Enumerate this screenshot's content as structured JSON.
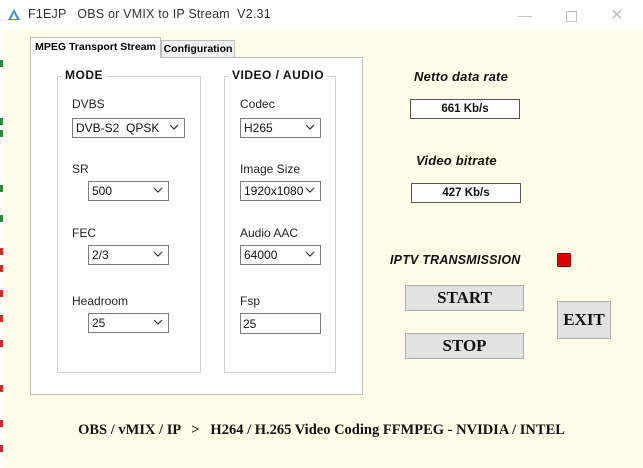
{
  "window": {
    "title": "F1EJP   OBS or VMIX to IP Stream  V2.31"
  },
  "tabs": [
    {
      "label": "MPEG Transport Stream",
      "active": true
    },
    {
      "label": "Configuration",
      "active": false
    }
  ],
  "mode": {
    "title": "MODE",
    "dvbs": {
      "label": "DVBS",
      "value": "DVB-S2  QPSK"
    },
    "sr": {
      "label": "SR",
      "value": "500"
    },
    "fec": {
      "label": "FEC",
      "value": "2/3"
    },
    "headroom": {
      "label": "Headroom",
      "value": "25"
    }
  },
  "video_audio": {
    "title": "VIDEO / AUDIO",
    "codec": {
      "label": "Codec",
      "value": "H265"
    },
    "image_size": {
      "label": "Image Size",
      "value": "1920x1080"
    },
    "audio_aac": {
      "label": "Audio AAC",
      "value": "64000"
    },
    "fsp": {
      "label": "Fsp",
      "value": "25"
    }
  },
  "stats": {
    "netto_label": "Netto data rate",
    "netto_value": "661 Kb/s",
    "video_label": "Video bitrate",
    "video_value": "427 Kb/s"
  },
  "iptv": {
    "label": "IPTV TRANSMISSION",
    "led_color": "#e00000"
  },
  "buttons": {
    "start": "START",
    "stop": "STOP",
    "exit": "EXIT"
  },
  "footer": "OBS / vMIX / IP   >   H264 / H.265 Video Coding FFMPEG - NVIDIA / INTEL"
}
